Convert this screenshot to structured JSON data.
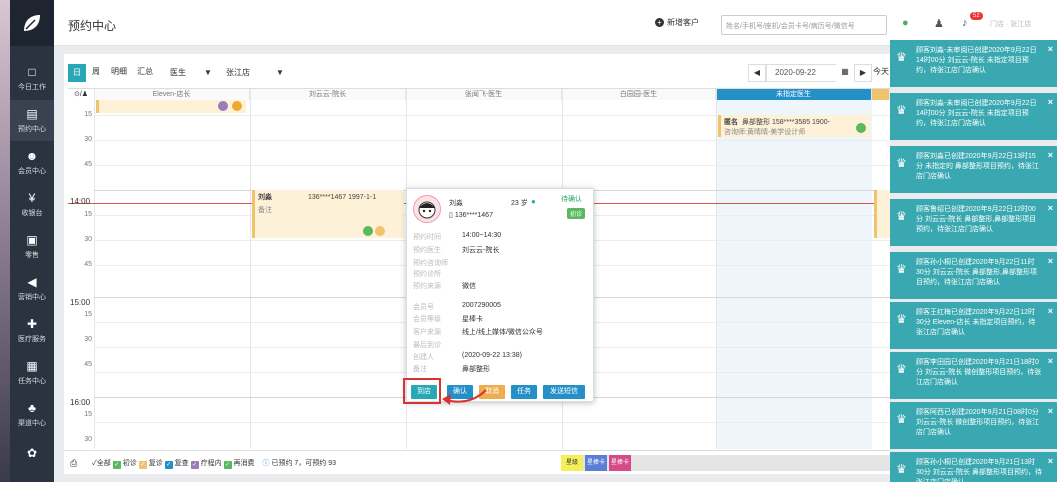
{
  "header": {
    "title": "预约中心",
    "new_customer": "新增客户",
    "search_placeholder": "姓名/手机号/座机/会员卡号/病历号/微信号",
    "user": "门店 · 张江店",
    "notif_count": "52"
  },
  "sidebar": {
    "items": [
      {
        "label": "今日工作",
        "icon": "□"
      },
      {
        "label": "预约中心",
        "icon": "▤"
      },
      {
        "label": "会员中心",
        "icon": "☻"
      },
      {
        "label": "收银台",
        "icon": "¥"
      },
      {
        "label": "零售",
        "icon": "▣"
      },
      {
        "label": "营销中心",
        "icon": "◀"
      },
      {
        "label": "医疗服务",
        "icon": "✚"
      },
      {
        "label": "任务中心",
        "icon": "▦"
      },
      {
        "label": "渠道中心",
        "icon": "♣"
      },
      {
        "label": "",
        "icon": "✿"
      }
    ]
  },
  "toolbar": {
    "views": [
      "日",
      "周",
      "明细",
      "汇总"
    ],
    "role_select": "医生",
    "store_select": "张江店",
    "date": "2020-09-22",
    "today": "今天"
  },
  "columns": [
    "Eleven-店长",
    "刘云云-院长",
    "张闻飞-医生",
    "白园园-医生",
    "未指定医生"
  ],
  "times": {
    "h13_15": "15",
    "h13_30": "30",
    "h13_45": "45",
    "h14": "14:00",
    "h14_15": "15",
    "h14_30": "30",
    "h14_45": "45",
    "h15": "15:00",
    "h15_15": "15",
    "h15_30": "30",
    "h15_45": "45",
    "h16": "16:00",
    "h16_15": "15",
    "h16_30": "30"
  },
  "appointments": {
    "a1_text": "刘淼",
    "a1_phone": "136****1467 1997-1-1",
    "a1_note": "备注",
    "a2_name": "匿名",
    "a2_text": "鼻部整形 158****3585 1900-",
    "a2_sub": "咨询师:黄晴晴-美学设计师"
  },
  "popup": {
    "name": "刘淼",
    "age": "23 岁",
    "phone": "136****1467",
    "status": "待确认",
    "status_tag": "初诊",
    "rows": [
      {
        "k": "预约时间",
        "v": "14:00~14:30"
      },
      {
        "k": "预约医生",
        "v": "刘云云-院长"
      },
      {
        "k": "预约咨询师",
        "v": ""
      },
      {
        "k": "预约诊所",
        "v": ""
      },
      {
        "k": "预约来源",
        "v": "微信"
      },
      {
        "k": "会员号",
        "v": "2007290005"
      },
      {
        "k": "会员等级",
        "v": "星棒卡"
      },
      {
        "k": "客户来源",
        "v": "线上/线上媒体/微信公众号"
      },
      {
        "k": "最后到诊",
        "v": ""
      },
      {
        "k": "创建人",
        "v": "(2020-09-22 13:38)"
      },
      {
        "k": "备注",
        "v": "鼻部整形"
      }
    ],
    "buttons": {
      "arrive": "到店",
      "confirm": "确认",
      "cancel": "取消",
      "task": "任务",
      "sms": "发送短信"
    }
  },
  "legend": {
    "all": "全部",
    "first": "初诊",
    "revisit": "复诊",
    "review": "复查",
    "treatment": "疗程内",
    "consume": "再消费",
    "summary": "已预约 7，可预约 93"
  },
  "legend_right": {
    "a": "星级",
    "b": "星棒卡",
    "c": "星棒卡"
  },
  "notices": [
    {
      "text": "顾客刘淼-未审阅已创建2020年9月22日14时00分 刘云云-院长 未指定项目预约，待张江店门店确认"
    },
    {
      "text": "顾客刘淼-未审阅已创建2020年9月22日14时00分 刘云云-院长 未指定项目预约，待张江店门店确认"
    },
    {
      "text": "顾客刘淼已创建2020年9月22日13时15分 未指定的 鼻部整形项目预约，待张江店门店确认"
    },
    {
      "text": "顾客鲁绍已创建2020年9月22日12时00分 刘云云-院长 鼻部整形,鼻部整形项目预约，待张江店门店确认"
    },
    {
      "text": "顾客孙小桐已创建2020年9月22日11时30分 刘云云-院长 鼻部整形,鼻部整形项目预约，待张江店门店确认"
    },
    {
      "text": "顾客王红梅已创建2020年9月22日12时30分 Eleven-店长 未指定项目预约，待张江店门店确认"
    },
    {
      "text": "顾客李田园已创建2020年9月21日18时0分 刘云云-院长 微创整形项目预约，待张江店门店确认"
    },
    {
      "text": "顾客阿西已创建2020年9月21日08时0分 刘云云-院长 微创整形项目预约，待张江店门店确认"
    },
    {
      "text": "顾客孙小桐已创建2020年9月21日13时30分 刘云云-院长 鼻部整形项目预约，待张江店门店确认"
    }
  ]
}
